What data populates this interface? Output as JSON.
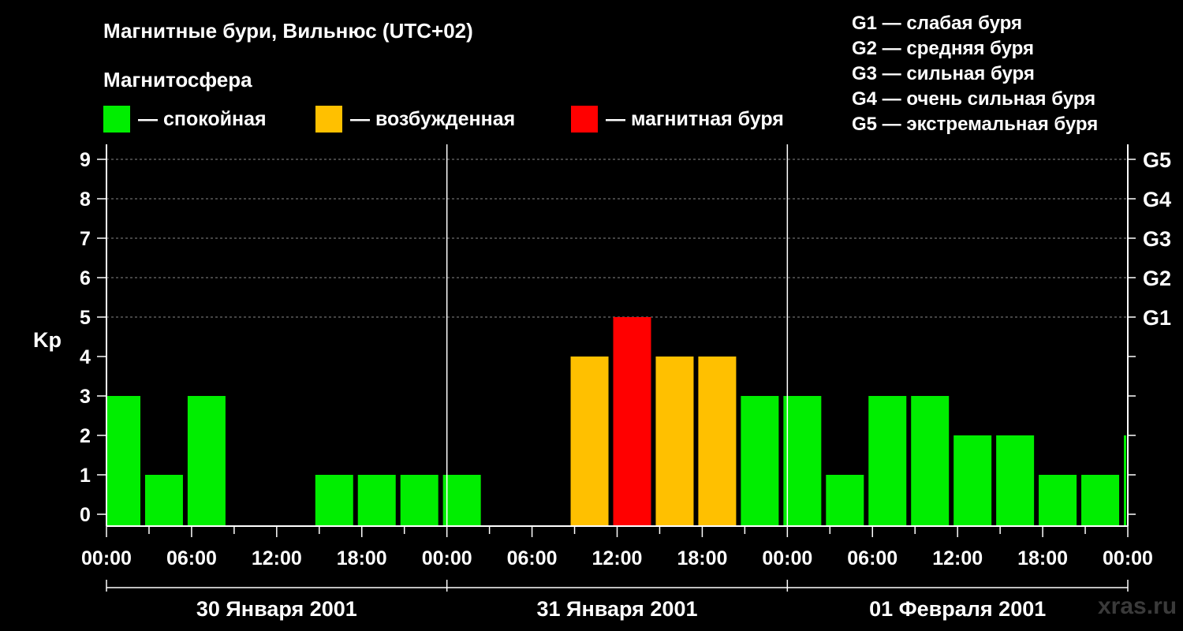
{
  "chart_data": {
    "type": "bar",
    "title": "Магнитные бури, Вильнюс (UTC+02)",
    "subtitle": "Магнитосфера",
    "ylabel": "Kp",
    "ylim": [
      0,
      9
    ],
    "y_ticks": [
      "0",
      "1",
      "2",
      "3",
      "4",
      "5",
      "6",
      "7",
      "8",
      "9"
    ],
    "g_ticks": [
      {
        "label": "G1",
        "value": 5
      },
      {
        "label": "G2",
        "value": 6
      },
      {
        "label": "G3",
        "value": 7
      },
      {
        "label": "G4",
        "value": 8
      },
      {
        "label": "G5",
        "value": 9
      }
    ],
    "x_tick_labels": [
      "00:00",
      "06:00",
      "12:00",
      "18:00",
      "00:00",
      "06:00",
      "12:00",
      "18:00",
      "00:00",
      "06:00",
      "12:00",
      "18:00",
      "00:00"
    ],
    "x_range_hours": [
      0,
      72
    ],
    "days": [
      "30 Января 2001",
      "31 Января 2001",
      "01 Февраля 2001"
    ],
    "categories": [
      "30.01 00:00",
      "30.01 03:00",
      "30.01 06:00",
      "30.01 09:00",
      "30.01 12:00",
      "30.01 15:00",
      "30.01 18:00",
      "30.01 21:00",
      "31.01 00:00",
      "31.01 03:00",
      "31.01 06:00",
      "31.01 09:00",
      "31.01 12:00",
      "31.01 15:00",
      "31.01 18:00",
      "31.01 21:00",
      "01.02 00:00",
      "01.02 03:00",
      "01.02 06:00",
      "01.02 09:00",
      "01.02 12:00",
      "01.02 15:00",
      "01.02 18:00",
      "01.02 21:00",
      "02.02 00:00"
    ],
    "values": [
      3,
      1,
      3,
      0,
      0,
      1,
      1,
      1,
      1,
      0,
      0,
      4,
      5,
      4,
      4,
      3,
      3,
      1,
      3,
      3,
      2,
      2,
      1,
      1,
      2
    ],
    "legend": [
      {
        "label": "— спокойная",
        "color": "#00ee00"
      },
      {
        "label": "— возбужденная",
        "color": "#ffc000"
      },
      {
        "label": "— магнитная буря",
        "color": "#ff0000"
      }
    ],
    "colors": {
      "quiet": "#00ee00",
      "active": "#ffc000",
      "storm": "#ff0000",
      "grid": "#888888"
    },
    "storm_scale": [
      "G1 — слабая буря",
      "G2 — средняя буря",
      "G3 — сильная буря",
      "G4 — очень сильная буря",
      "G5 — экстремальная буря"
    ],
    "grid": true
  },
  "watermark": "xras.ru"
}
